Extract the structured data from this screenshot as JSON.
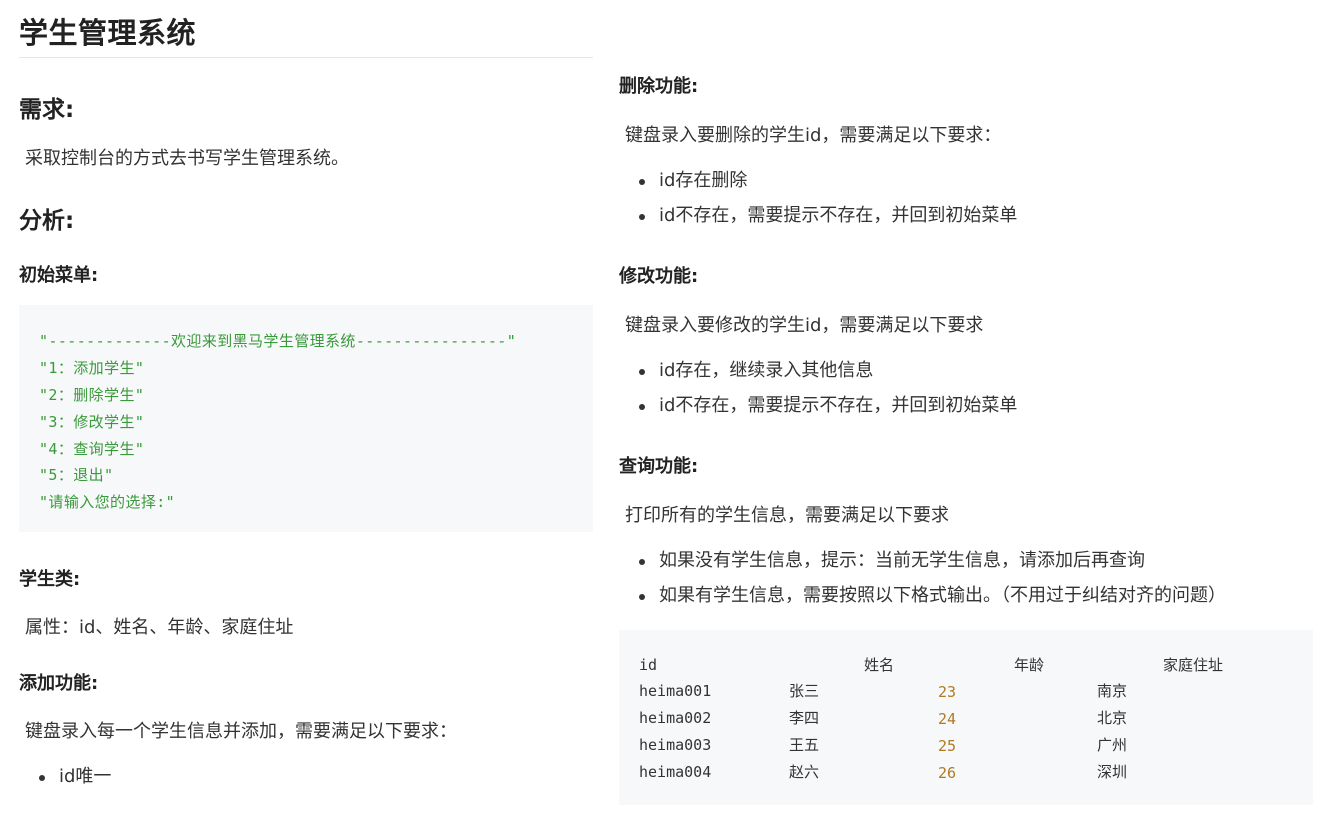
{
  "doc": {
    "title": "学生管理系统",
    "sections": {
      "requirement": {
        "heading": "需求:",
        "text": "采取控制台的方式去书写学生管理系统。"
      },
      "analysis": {
        "heading": "分析:",
        "initial_menu": {
          "heading": "初始菜单:",
          "code_lines": [
            "\"-------------欢迎来到黑马学生管理系统----------------\"",
            "\"1：添加学生\"",
            "\"2：删除学生\"",
            "\"3：修改学生\"",
            "\"4：查询学生\"",
            "\"5：退出\"",
            "\"请输入您的选择:\""
          ]
        },
        "student_class": {
          "heading": "学生类:",
          "text": "属性：id、姓名、年龄、家庭住址"
        },
        "add": {
          "heading": "添加功能:",
          "text": "键盘录入每一个学生信息并添加，需要满足以下要求：",
          "items": [
            "id唯一"
          ]
        },
        "delete": {
          "heading": "删除功能:",
          "text": "键盘录入要删除的学生id，需要满足以下要求：",
          "items": [
            "id存在删除",
            "id不存在，需要提示不存在，并回到初始菜单"
          ]
        },
        "modify": {
          "heading": "修改功能:",
          "text": "键盘录入要修改的学生id，需要满足以下要求",
          "items": [
            "id存在，继续录入其他信息",
            "id不存在，需要提示不存在，并回到初始菜单"
          ]
        },
        "query": {
          "heading": "查询功能:",
          "text": "打印所有的学生信息，需要满足以下要求",
          "items": [
            "如果没有学生信息，提示：当前无学生信息，请添加后再查询",
            "如果有学生信息，需要按照以下格式输出。（不用过于纠结对齐的问题）"
          ],
          "table": {
            "headers": [
              "id",
              "姓名",
              "年龄",
              "家庭住址"
            ],
            "rows": [
              [
                "heima001",
                "张三",
                "23",
                "南京"
              ],
              [
                "heima002",
                "李四",
                "24",
                "北京"
              ],
              [
                "heima003",
                "王五",
                "25",
                "广州"
              ],
              [
                "heima004",
                "赵六",
                "26",
                "深圳"
              ]
            ]
          }
        }
      }
    }
  }
}
